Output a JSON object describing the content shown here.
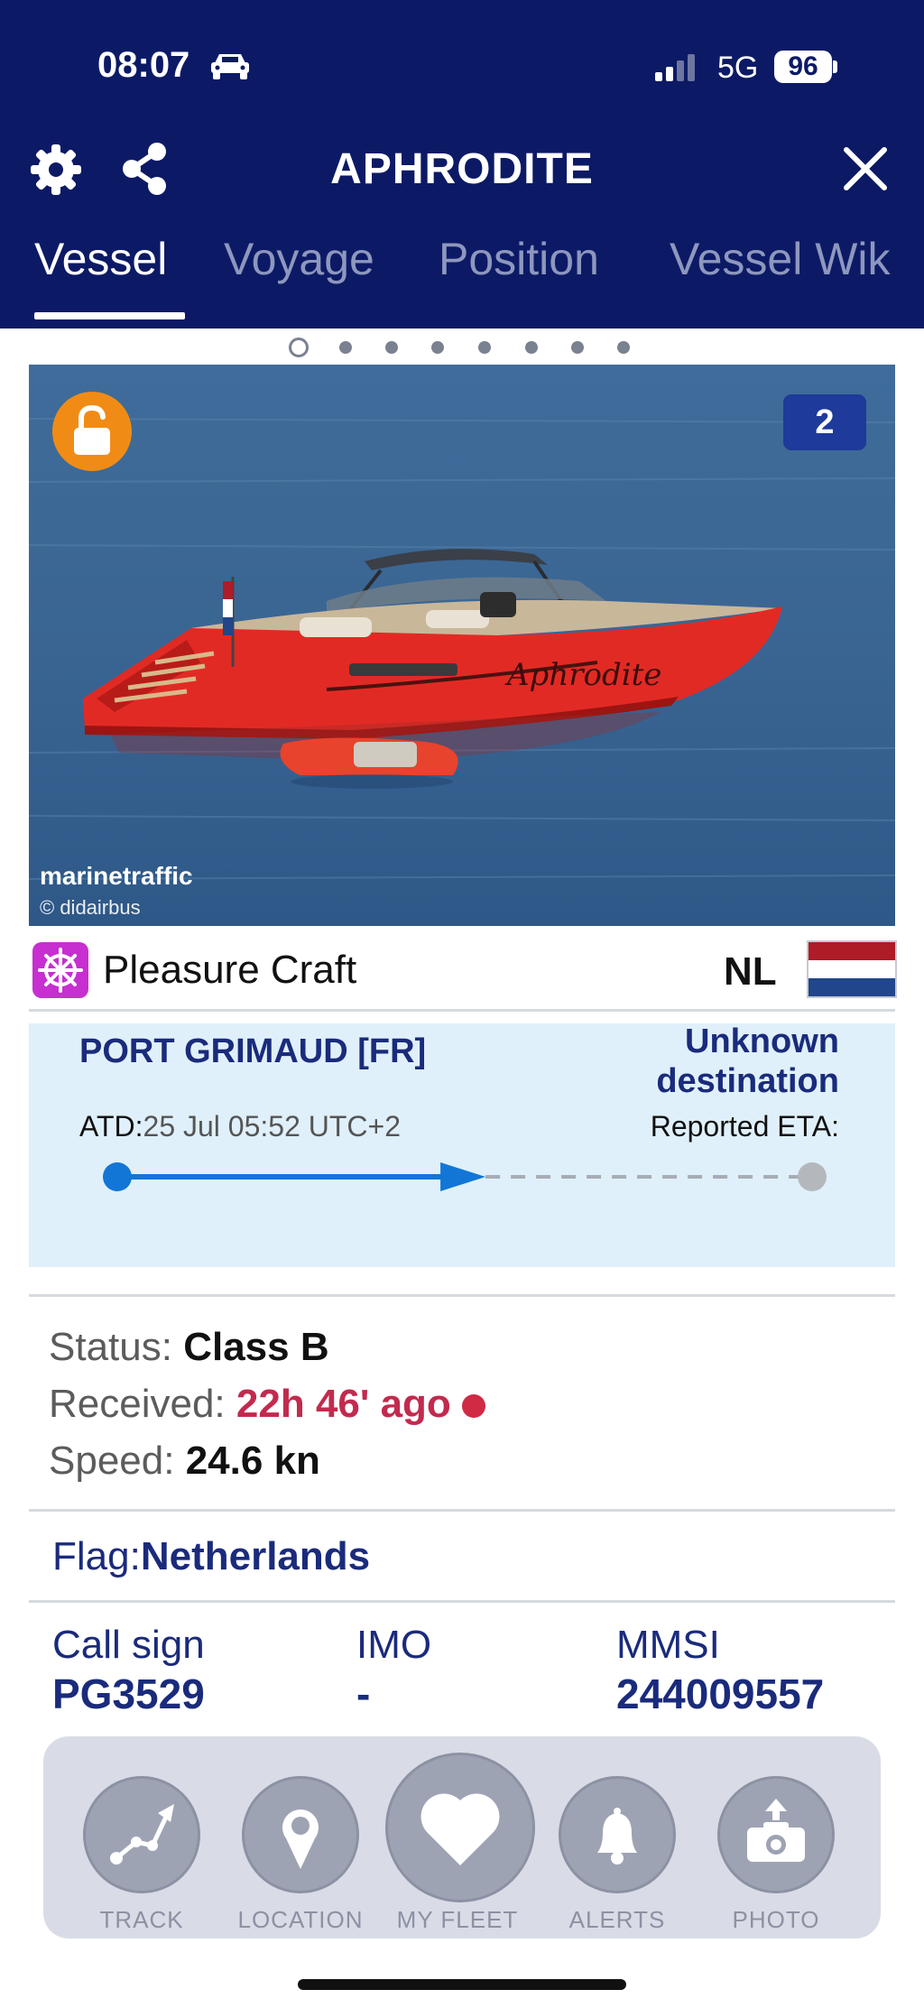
{
  "status_bar": {
    "time": "08:07",
    "network": "5G",
    "battery": "96"
  },
  "header": {
    "title": "APHRODITE",
    "tabs": [
      {
        "label": "Vessel",
        "active": true
      },
      {
        "label": "Voyage",
        "active": false
      },
      {
        "label": "Position",
        "active": false
      },
      {
        "label": "Vessel Wik",
        "active": false
      }
    ]
  },
  "pager": {
    "pages": 8,
    "current": 1
  },
  "photo": {
    "count_badge": "2",
    "watermark": "marinetraffic",
    "credit": "© didairbus",
    "hull_name": "Aphrodite"
  },
  "vessel": {
    "type": "Pleasure Craft",
    "country_code": "NL",
    "flag_colors": [
      "#ae1c28",
      "#ffffff",
      "#21468b"
    ]
  },
  "voyage": {
    "departure_port": "PORT GRIMAUD [FR]",
    "destination_line1": "Unknown",
    "destination_line2": "destination",
    "atd_label": "ATD:",
    "atd_value": "25 Jul 05:52 UTC+2",
    "eta_label": "Reported ETA:",
    "progress_fraction": 0.53
  },
  "status": {
    "status_label": "Status:",
    "status_value": "Class B",
    "received_label": "Received:",
    "received_value": "22h 46' ago",
    "speed_label": "Speed:",
    "speed_value": "24.6 kn"
  },
  "flag": {
    "label": "Flag:",
    "value": "Netherlands"
  },
  "identifiers": {
    "callsign_label": "Call sign",
    "callsign_value": "PG3529",
    "imo_label": "IMO",
    "imo_value": "-",
    "mmsi_label": "MMSI",
    "mmsi_value": "244009557"
  },
  "toolbar": {
    "track": "TRACK",
    "location": "LOCATION",
    "my_fleet": "MY FLEET",
    "alerts": "ALERTS",
    "photo": "PHOTO"
  },
  "colors": {
    "header_bg": "#0c1a66",
    "accent_blue": "#1176d6",
    "lock_orange": "#f08c15",
    "alert_red": "#c22a4e",
    "type_magenta": "#c72fd0"
  }
}
